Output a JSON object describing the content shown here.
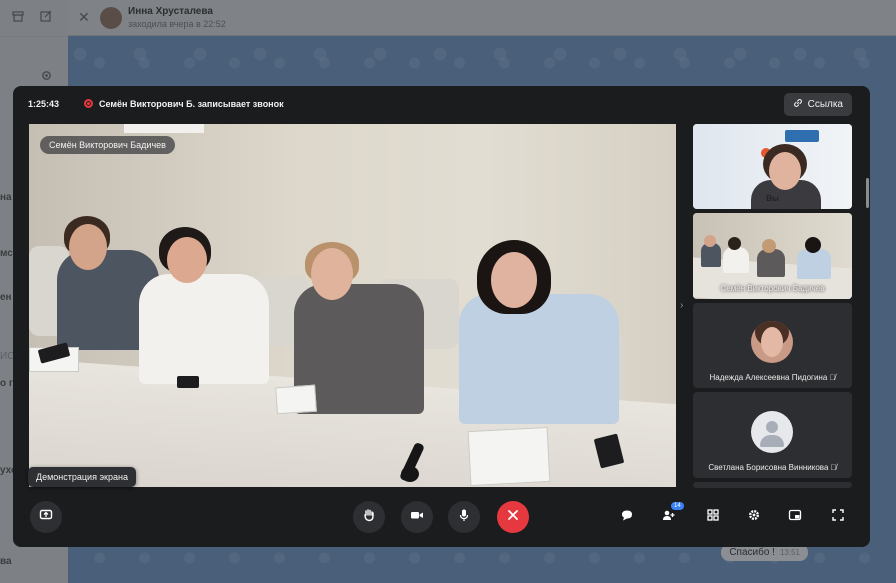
{
  "background": {
    "contact_name": "Инна Хрусталева",
    "contact_status": "заходила вчера в 22:52",
    "message_text": "Спасибо !",
    "message_time": "13:51",
    "sidebar_fragments": [
      "на",
      "мс",
      "ен",
      "ИС",
      "о г",
      "ухо",
      "ва"
    ]
  },
  "call": {
    "timer": "1:25:43",
    "recording_text": "Семён Викторович Б. записывает звонок",
    "link_label": "Ссылка",
    "main_speaker": "Семён Викторович Бадичев",
    "tooltip": "Демонстрация экрана",
    "participants_count": "14",
    "tiles": [
      {
        "label": "Вы"
      },
      {
        "label": "Семён Викторович Бадичев"
      },
      {
        "label": "Надежда Алексеевна Пидогина"
      },
      {
        "label": "Светлана Борисовна Винникова"
      }
    ]
  },
  "colors": {
    "end_call": "#e5393f",
    "badge": "#3b82f6",
    "window": "#1b1c1e"
  },
  "icons": [
    "archive-icon",
    "compose-icon",
    "gear-icon",
    "close-icon",
    "record-icon",
    "link-icon",
    "screen-share-icon",
    "raise-hand-icon",
    "camera-icon",
    "microphone-icon",
    "end-call-icon",
    "chat-icon",
    "participants-icon",
    "grid-icon",
    "settings-icon",
    "pip-icon",
    "fullscreen-icon",
    "muted-mic-icon",
    "chevron-right-icon"
  ]
}
